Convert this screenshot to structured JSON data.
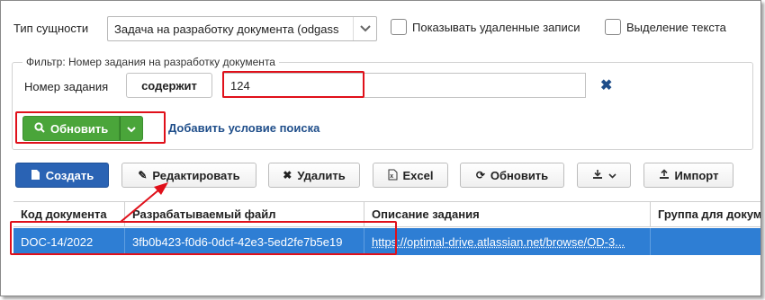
{
  "entity": {
    "label": "Тип сущности",
    "value": "Задача на разработку документа (odgass",
    "show_deleted": "Показывать удаленные записи",
    "text_selection": "Выделение текста"
  },
  "filter": {
    "legend": "Фильтр: Номер задания на разработку документа",
    "field_label": "Номер задания",
    "operator": "содержит",
    "value": "124",
    "remove_icon": "close-icon",
    "refresh_label": "Обновить",
    "add_condition": "Добавить условие поиска"
  },
  "toolbar": {
    "create": "Создать",
    "edit": "Редактировать",
    "delete": "Удалить",
    "excel": "Excel",
    "refresh": "Обновить",
    "import": "Импорт"
  },
  "grid": {
    "columns": [
      "Код документа",
      "Разрабатываемый файл",
      "Описание задания",
      "Группа для докум"
    ],
    "rows": [
      [
        "DOC-14/2022",
        "3fb0b423-f0d6-0dcf-42e3-5ed2fe7b5e19",
        "https://optimal-drive.atlassian.net/browse/OD-3...",
        ""
      ]
    ]
  },
  "colors": {
    "accent": "#2a63b4",
    "success": "#4aa53a",
    "selection": "#2e7ed4",
    "annotation": "#e0101a",
    "link": "#1f4e8a"
  }
}
